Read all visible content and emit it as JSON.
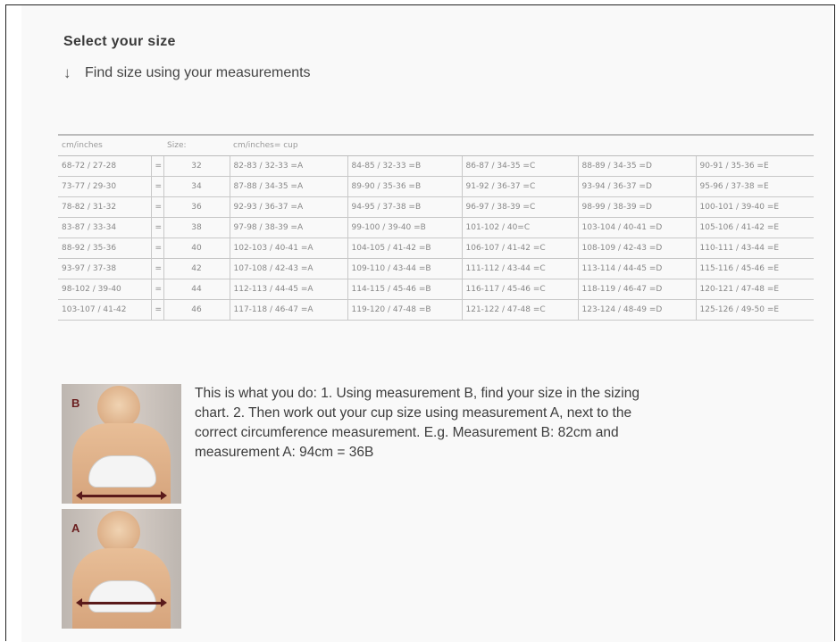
{
  "title": "Select your size",
  "find_link": {
    "icon": "arrow-down-icon",
    "label": "Find size using your measurements"
  },
  "table": {
    "headers": [
      "cm/inches",
      "",
      "Size:",
      "cm/inches= cup",
      "",
      "",
      "",
      ""
    ],
    "rows": [
      [
        "68-72 / 27-28",
        "=",
        "32",
        "82-83 / 32-33 =A",
        "84-85 / 32-33 =B",
        "86-87 / 34-35 =C",
        "88-89 / 34-35 =D",
        "90-91 / 35-36 =E"
      ],
      [
        "73-77 / 29-30",
        "=",
        "34",
        "87-88 / 34-35 =A",
        "89-90 / 35-36 =B",
        "91-92 / 36-37 =C",
        "93-94 / 36-37 =D",
        "95-96 / 37-38 =E"
      ],
      [
        "78-82 / 31-32",
        "=",
        "36",
        "92-93 / 36-37 =A",
        "94-95 / 37-38 =B",
        "96-97 / 38-39 =C",
        "98-99 / 38-39 =D",
        "100-101 / 39-40 =E"
      ],
      [
        "83-87 / 33-34",
        "=",
        "38",
        "97-98 / 38-39 =A",
        "99-100 / 39-40 =B",
        "101-102 / 40=C",
        "103-104 / 40-41 =D",
        "105-106 / 41-42 =E"
      ],
      [
        "88-92 / 35-36",
        "=",
        "40",
        "102-103 / 40-41 =A",
        "104-105 / 41-42 =B",
        "106-107 / 41-42 =C",
        "108-109 / 42-43 =D",
        "110-111 / 43-44 =E"
      ],
      [
        "93-97 / 37-38",
        "=",
        "42",
        "107-108 / 42-43 =A",
        "109-110 / 43-44 =B",
        "111-112 / 43-44 =C",
        "113-114 / 44-45 =D",
        "115-116 / 45-46 =E"
      ],
      [
        "98-102 / 39-40",
        "=",
        "44",
        "112-113 / 44-45 =A",
        "114-115 / 45-46 =B",
        "116-117 / 45-46 =C",
        "118-119 / 46-47 =D",
        "120-121 / 47-48 =E"
      ],
      [
        "103-107 / 41-42",
        "=",
        "46",
        "117-118 / 46-47 =A",
        "119-120 / 47-48 =B",
        "121-122 / 47-48 =C",
        "123-124 / 48-49 =D",
        "125-126 / 49-50 =E"
      ]
    ]
  },
  "images": [
    {
      "letter": "B",
      "name": "measurement-b-photo"
    },
    {
      "letter": "A",
      "name": "measurement-a-photo"
    }
  ],
  "instructions": "This is what you do: 1. Using measurement B, find your size in the sizing chart. 2. Then work out your cup size using measurement A, next to the correct circumference measurement. E.g. Measurement B: 82cm and measurement A: 94cm = 36B"
}
